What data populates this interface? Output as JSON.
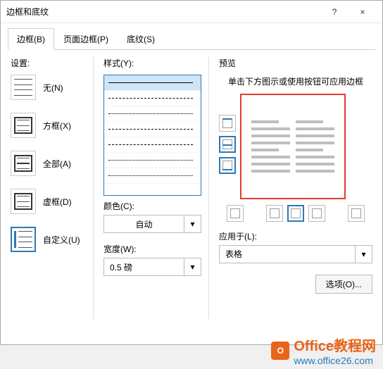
{
  "dialog": {
    "title": "边框和底纹",
    "help": "?",
    "close": "×"
  },
  "tabs": {
    "border": "边框(B)",
    "page_border": "页面边框(P)",
    "shading": "底纹(S)"
  },
  "settings": {
    "label": "设置:",
    "none": "无(N)",
    "box": "方框(X)",
    "all": "全部(A)",
    "grid": "虚框(D)",
    "custom": "自定义(U)"
  },
  "style": {
    "label": "样式(Y):",
    "color_label": "颜色(C):",
    "color_value": "自动",
    "width_label": "宽度(W):",
    "width_value": "0.5 磅"
  },
  "preview": {
    "label": "预览",
    "hint": "单击下方图示或使用按钮可应用边框",
    "apply_label": "应用于(L):",
    "apply_value": "表格",
    "options_btn": "选项(O)..."
  },
  "watermark": {
    "badge": "O",
    "brand": "Office教程网",
    "url": "www.office26.com"
  }
}
